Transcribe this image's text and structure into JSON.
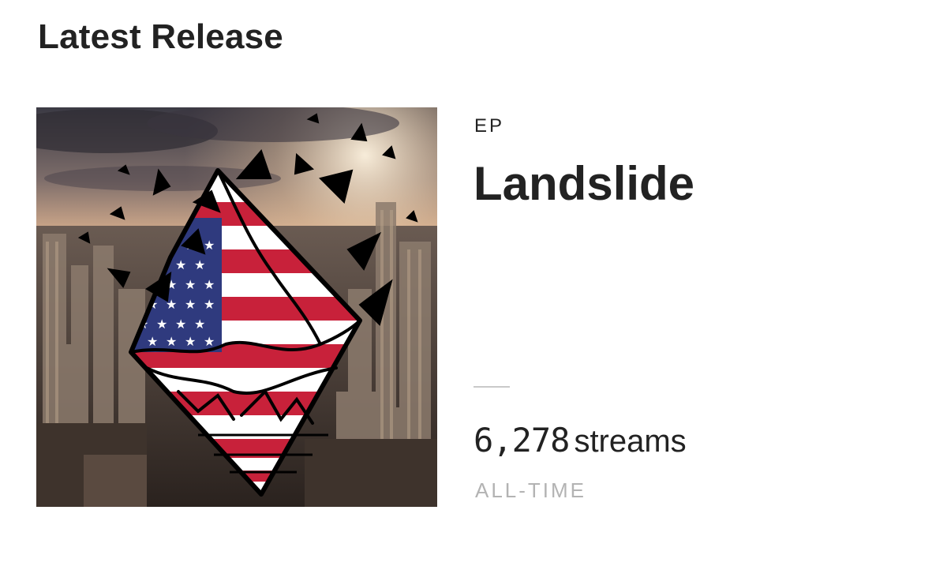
{
  "section": {
    "title": "Latest Release"
  },
  "release": {
    "type": "EP",
    "title": "Landslide",
    "artwork_icon": "album-cover-art"
  },
  "stats": {
    "count": "6,278",
    "unit": "streams",
    "period": "ALL-TIME"
  },
  "colors": {
    "text": "#222222",
    "muted": "#b3b3b3",
    "divider": "#c9c9c9",
    "flag_red": "#c8213a",
    "flag_blue": "#2f3a7e"
  }
}
